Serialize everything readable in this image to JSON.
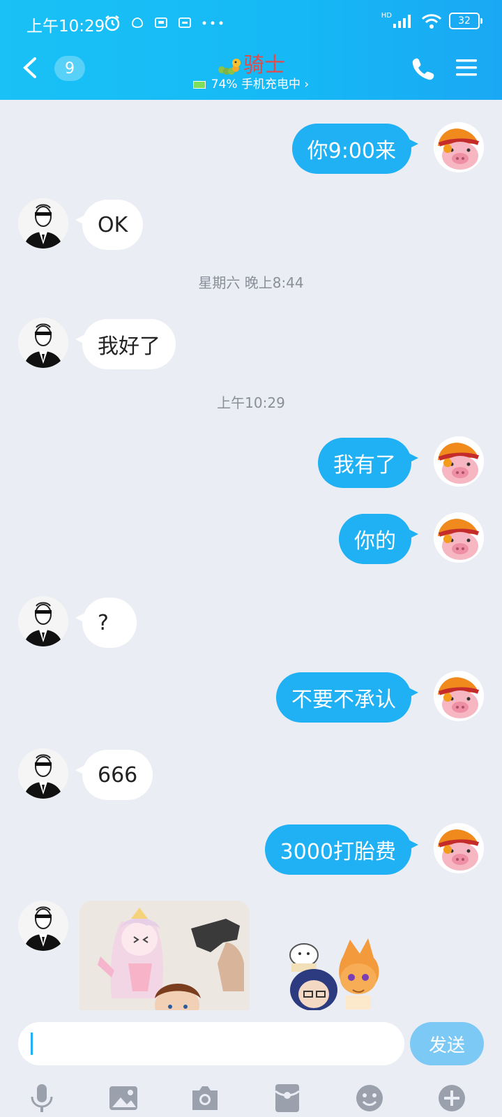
{
  "status_bar": {
    "time": "上午10:29",
    "battery": "32",
    "network": "HD"
  },
  "header": {
    "unread_count": "9",
    "contact_name": "骑士",
    "contact_status": "74% 手机充电中 ›"
  },
  "messages": [
    {
      "direction": "out",
      "text": "你9:00来"
    },
    {
      "direction": "in",
      "text": "OK"
    },
    {
      "type": "timestamp",
      "text": "星期六 晚上8:44"
    },
    {
      "direction": "in",
      "text": "我好了"
    },
    {
      "type": "timestamp",
      "text": "上午10:29"
    },
    {
      "direction": "out",
      "text": "我有了"
    },
    {
      "direction": "out",
      "text": "你的"
    },
    {
      "direction": "in",
      "text": "?"
    },
    {
      "direction": "out",
      "text": "不要不承认"
    },
    {
      "direction": "in",
      "text": "666"
    },
    {
      "direction": "out",
      "text": "3000打胎费"
    },
    {
      "direction": "in",
      "type": "image"
    }
  ],
  "input": {
    "placeholder": "",
    "send_label": "发送"
  },
  "toolbar": {
    "icons": [
      "microphone-icon",
      "image-icon",
      "camera-icon",
      "red-packet-icon",
      "emoji-icon",
      "plus-icon"
    ]
  }
}
